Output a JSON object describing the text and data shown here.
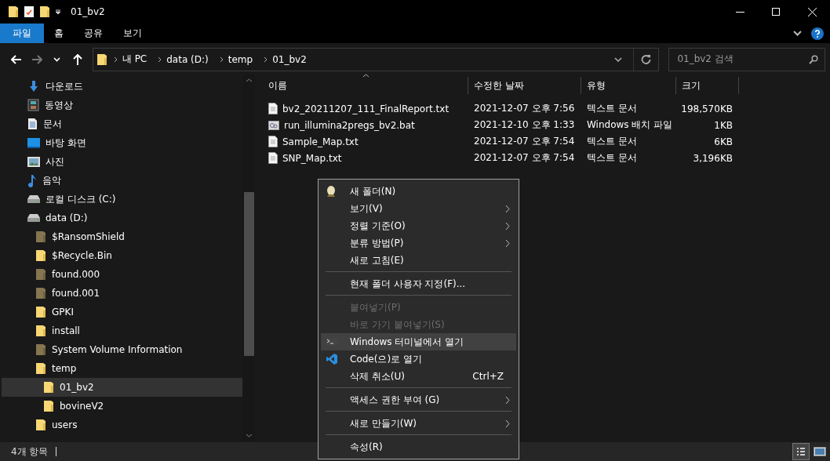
{
  "window": {
    "title": "01_bv2"
  },
  "ribbon": {
    "tabs": [
      {
        "label": "파일",
        "selected": true
      },
      {
        "label": "홈",
        "selected": false
      },
      {
        "label": "공유",
        "selected": false
      },
      {
        "label": "보기",
        "selected": false
      }
    ]
  },
  "nav_buttons": [
    {
      "kind": "back",
      "disabled": false
    },
    {
      "kind": "forward",
      "disabled": true
    },
    {
      "kind": "recent",
      "disabled": false
    },
    {
      "kind": "up",
      "disabled": false
    }
  ],
  "address": {
    "path": [
      "내 PC",
      "data (D:)",
      "temp",
      "01_bv2"
    ]
  },
  "search": {
    "placeholder": "01_bv2 검색"
  },
  "sidebar": {
    "items": [
      {
        "label": "다운로드",
        "kind": "download",
        "selected": false
      },
      {
        "label": "동영상",
        "kind": "video",
        "selected": false
      },
      {
        "label": "문서",
        "kind": "document",
        "selected": false
      },
      {
        "label": "바탕 화면",
        "kind": "desktop",
        "selected": false
      },
      {
        "label": "사진",
        "kind": "picture",
        "selected": false
      },
      {
        "label": "음악",
        "kind": "music",
        "selected": false
      },
      {
        "label": "로컬 디스크 (C:)",
        "kind": "drive",
        "selected": false
      },
      {
        "label": "data (D:)",
        "kind": "drive",
        "selected": false,
        "children": [
          {
            "label": "$RansomShield",
            "kind": "system-folder",
            "selected": false
          },
          {
            "label": "$Recycle.Bin",
            "kind": "folder",
            "selected": false
          },
          {
            "label": "found.000",
            "kind": "system-folder",
            "selected": false
          },
          {
            "label": "found.001",
            "kind": "system-folder",
            "selected": false
          },
          {
            "label": "GPKI",
            "kind": "folder",
            "selected": false
          },
          {
            "label": "install",
            "kind": "folder",
            "selected": false
          },
          {
            "label": "System Volume Information",
            "kind": "system-folder",
            "selected": false
          },
          {
            "label": "temp",
            "kind": "folder",
            "selected": false,
            "children": [
              {
                "label": "01_bv2",
                "kind": "folder",
                "selected": true
              },
              {
                "label": "bovineV2",
                "kind": "folder",
                "selected": false
              }
            ]
          },
          {
            "label": "users",
            "kind": "folder",
            "selected": false
          }
        ]
      }
    ]
  },
  "columns": [
    {
      "label": "이름",
      "sorted": true
    },
    {
      "label": "수정한 날짜",
      "sorted": false
    },
    {
      "label": "유형",
      "sorted": false
    },
    {
      "label": "크기",
      "sorted": false
    }
  ],
  "files": [
    {
      "kind": "text",
      "name": "bv2_20211207_111_FinalReport.txt",
      "modified": "2021-12-07 오후 7:56",
      "type": "텍스트 문서",
      "size": "198,570KB"
    },
    {
      "kind": "batch",
      "name": "run_illumina2pregs_bv2.bat",
      "modified": "2021-12-10 오후 1:33",
      "type": "Windows 배치 파일",
      "size": "1KB"
    },
    {
      "kind": "text",
      "name": "Sample_Map.txt",
      "modified": "2021-12-07 오후 7:54",
      "type": "텍스트 문서",
      "size": "6KB"
    },
    {
      "kind": "text",
      "name": "SNP_Map.txt",
      "modified": "2021-12-07 오후 7:54",
      "type": "텍스트 문서",
      "size": "3,196KB"
    }
  ],
  "context_menu": {
    "items": [
      {
        "kind": "new-folder",
        "label": "새 폴더(N)",
        "disabled": false,
        "selected": false
      },
      {
        "kind": "submenu",
        "label": "보기(V)",
        "disabled": false,
        "selected": false
      },
      {
        "kind": "submenu",
        "label": "정렬 기준(O)",
        "disabled": false,
        "selected": false
      },
      {
        "kind": "submenu",
        "label": "분류 방법(P)",
        "disabled": false,
        "selected": false
      },
      {
        "kind": "plain",
        "label": "새로 고침(E)",
        "disabled": false,
        "selected": false
      },
      {
        "kind": "separator"
      },
      {
        "kind": "plain",
        "label": "현재 폴더 사용자 지정(F)...",
        "disabled": false,
        "selected": false
      },
      {
        "kind": "separator"
      },
      {
        "kind": "plain",
        "label": "붙여넣기(P)",
        "disabled": true,
        "selected": false
      },
      {
        "kind": "plain",
        "label": "바로 가기 붙여넣기(S)",
        "disabled": true,
        "selected": false
      },
      {
        "kind": "terminal",
        "label": "Windows 터미널에서 열기",
        "disabled": false,
        "selected": true
      },
      {
        "kind": "code",
        "label": "Code(으)로 열기",
        "disabled": false,
        "selected": false
      },
      {
        "kind": "plain",
        "label": "삭제 취소(U)",
        "shortcut": "Ctrl+Z",
        "disabled": false,
        "selected": false
      },
      {
        "kind": "separator"
      },
      {
        "kind": "submenu",
        "label": "액세스 권한 부여 (G)",
        "disabled": false,
        "selected": false
      },
      {
        "kind": "separator"
      },
      {
        "kind": "submenu",
        "label": "새로 만들기(W)",
        "disabled": false,
        "selected": false
      },
      {
        "kind": "separator"
      },
      {
        "kind": "plain",
        "label": "속성(R)",
        "disabled": false,
        "selected": false
      }
    ]
  },
  "status_bar": {
    "text": "4개 항목",
    "views": [
      {
        "kind": "details",
        "selected": true
      },
      {
        "kind": "thumbnails",
        "selected": false
      }
    ]
  }
}
